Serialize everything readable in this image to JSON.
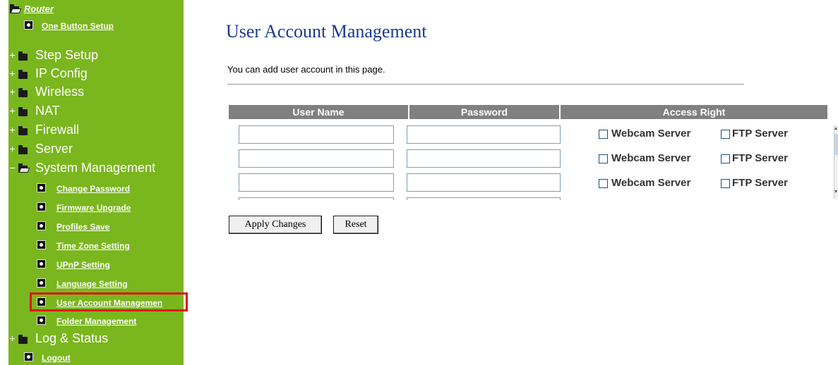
{
  "sidebar": {
    "root": "Router",
    "one_button_setup": "One Button Setup",
    "step_setup": "Step Setup",
    "ip_config": "IP Config",
    "wireless": "Wireless",
    "nat": "NAT",
    "firewall": "Firewall",
    "server": "Server",
    "system_management": "System Management",
    "change_password": "Change Password",
    "firmware_upgrade": "Firmware Upgrade",
    "profiles_save": "Profiles Save",
    "time_zone_setting": "Time Zone Setting",
    "upnp_setting": "UPnP Setting",
    "language_setting": "Language Setting",
    "user_account_management": "User Account Managemen",
    "folder_management": "Folder Management",
    "log_status": "Log & Status",
    "logout": "Logout"
  },
  "main": {
    "title": "User Account Management",
    "description": "You can add user account in this page."
  },
  "table": {
    "headers": [
      "User Name",
      "Password",
      "Access Right"
    ],
    "webcam_label": "Webcam Server",
    "ftp_label": "FTP Server",
    "rows": [
      {
        "user": "",
        "password": "",
        "webcam": false,
        "ftp": false
      },
      {
        "user": "",
        "password": "",
        "webcam": false,
        "ftp": false
      },
      {
        "user": "",
        "password": "",
        "webcam": false,
        "ftp": false
      }
    ]
  },
  "buttons": {
    "apply": "Apply Changes",
    "reset": "Reset"
  },
  "colors": {
    "sidebar_bg": "#7ab61e",
    "title": "#1a3a8c",
    "header_bg": "#808080",
    "highlight": "#e01010"
  }
}
